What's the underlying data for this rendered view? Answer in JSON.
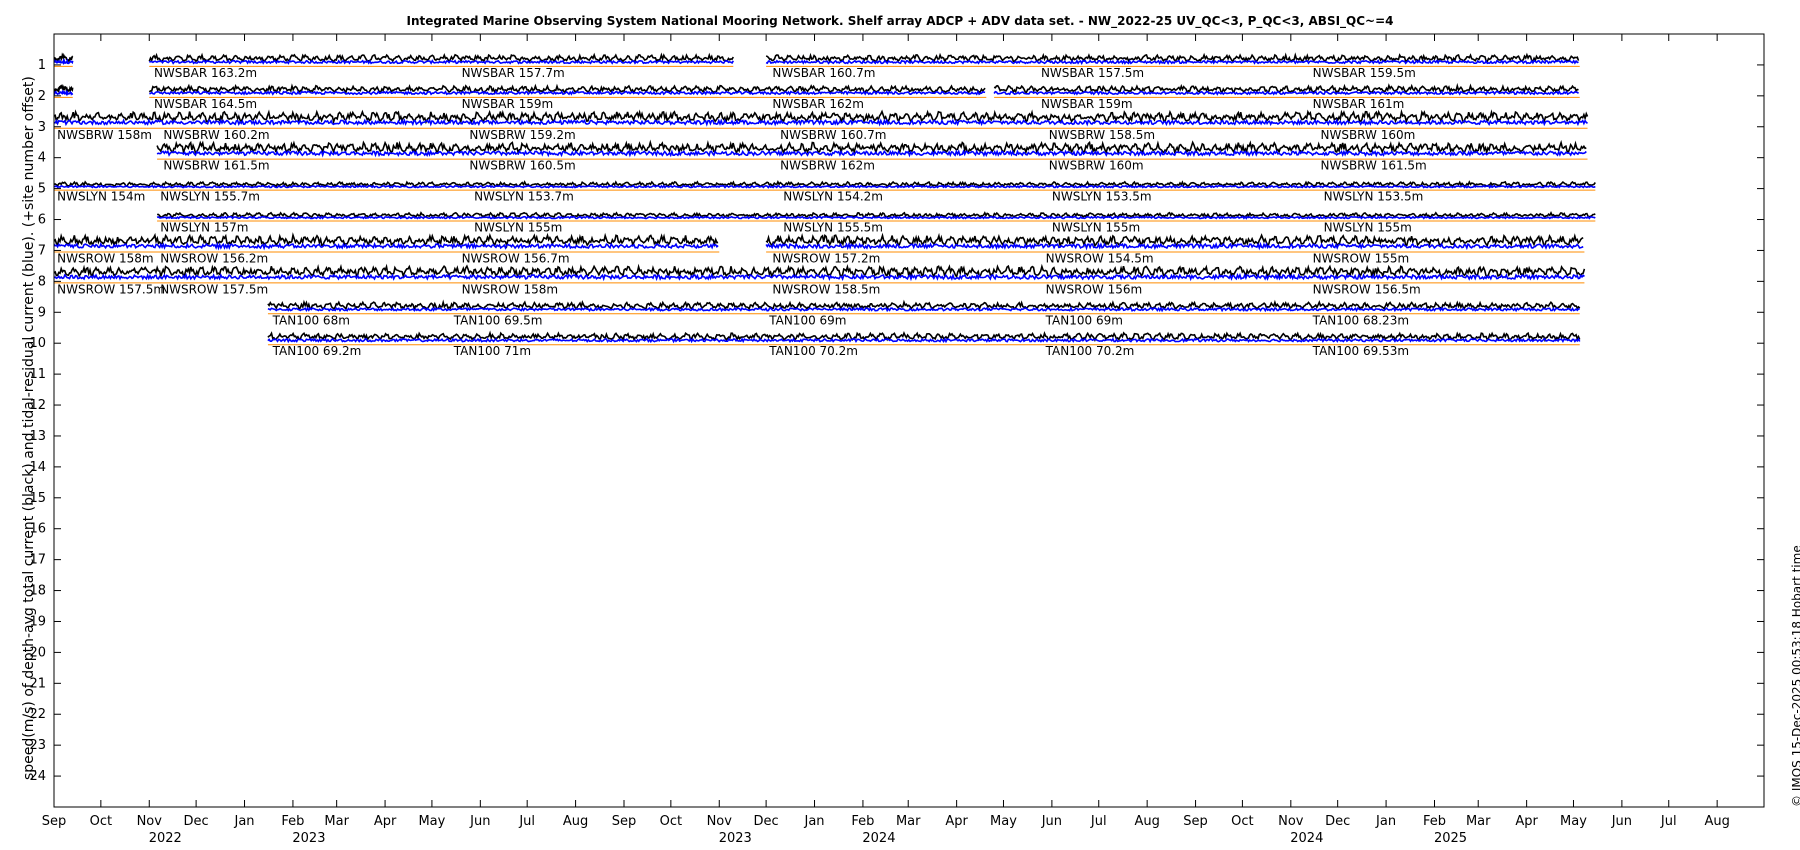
{
  "chart_data": {
    "type": "line",
    "title": "Integrated Marine Observing System National Mooring Network. Shelf array ADCP + ADV data set. - NW_2022-25 UV_QC<3, P_QC<3, ABSI_QC~=4",
    "ylabel": "speed(m/s) of depth-avg total current (black) and tidal-residual current (blue). (+site number offset)",
    "credit": "© IMOS 15-Dec-2025 00:53:18 Hobart time",
    "x_range": [
      "2022-09-01",
      "2025-08-31"
    ],
    "ylim": [
      0,
      25
    ],
    "y_reversed": true,
    "y_ticks": [
      1,
      2,
      3,
      4,
      5,
      6,
      7,
      8,
      9,
      10,
      11,
      12,
      13,
      14,
      15,
      16,
      17,
      18,
      19,
      20,
      21,
      22,
      23,
      24
    ],
    "x_ticks": [
      {
        "date": "2022-09-01",
        "label": "Sep"
      },
      {
        "date": "2022-10-01",
        "label": "Oct"
      },
      {
        "date": "2022-11-01",
        "label": "Nov",
        "year": "2022"
      },
      {
        "date": "2022-12-01",
        "label": "Dec"
      },
      {
        "date": "2023-01-01",
        "label": "Jan"
      },
      {
        "date": "2023-02-01",
        "label": "Feb",
        "year": "2023"
      },
      {
        "date": "2023-03-01",
        "label": "Mar"
      },
      {
        "date": "2023-04-01",
        "label": "Apr"
      },
      {
        "date": "2023-05-01",
        "label": "May"
      },
      {
        "date": "2023-06-01",
        "label": "Jun"
      },
      {
        "date": "2023-07-01",
        "label": "Jul"
      },
      {
        "date": "2023-08-01",
        "label": "Aug"
      },
      {
        "date": "2023-09-01",
        "label": "Sep"
      },
      {
        "date": "2023-10-01",
        "label": "Oct"
      },
      {
        "date": "2023-11-01",
        "label": "Nov",
        "year": "2023"
      },
      {
        "date": "2023-12-01",
        "label": "Dec"
      },
      {
        "date": "2024-01-01",
        "label": "Jan"
      },
      {
        "date": "2024-02-01",
        "label": "Feb",
        "year": "2024"
      },
      {
        "date": "2024-03-01",
        "label": "Mar"
      },
      {
        "date": "2024-04-01",
        "label": "Apr"
      },
      {
        "date": "2024-05-01",
        "label": "May"
      },
      {
        "date": "2024-06-01",
        "label": "Jun"
      },
      {
        "date": "2024-07-01",
        "label": "Jul"
      },
      {
        "date": "2024-08-01",
        "label": "Aug"
      },
      {
        "date": "2024-09-01",
        "label": "Sep"
      },
      {
        "date": "2024-10-01",
        "label": "Oct"
      },
      {
        "date": "2024-11-01",
        "label": "Nov",
        "year": "2024"
      },
      {
        "date": "2024-12-01",
        "label": "Dec"
      },
      {
        "date": "2025-01-01",
        "label": "Jan"
      },
      {
        "date": "2025-02-01",
        "label": "Feb",
        "year": "2025"
      },
      {
        "date": "2025-03-01",
        "label": "Mar"
      },
      {
        "date": "2025-04-01",
        "label": "Apr"
      },
      {
        "date": "2025-05-01",
        "label": "May"
      },
      {
        "date": "2025-06-01",
        "label": "Jun"
      },
      {
        "date": "2025-07-01",
        "label": "Jul"
      },
      {
        "date": "2025-08-01",
        "label": "Aug"
      }
    ],
    "colors": {
      "total": "#000000",
      "residual": "#0000ff",
      "zero_line_a": "#ff8c00",
      "zero_line_b": "#00cc66"
    },
    "rows": [
      {
        "site": 1,
        "amp": 0.3,
        "segments": [
          [
            "2022-09-01",
            "2022-09-13"
          ],
          [
            "2022-11-01",
            "2023-11-10"
          ],
          [
            "2023-12-01",
            "2025-05-05"
          ]
        ],
        "labels": [
          {
            "date": "2022-11-04",
            "text": "NWSBAR 163.2m"
          },
          {
            "date": "2023-05-20",
            "text": "NWSBAR 157.7m"
          },
          {
            "date": "2023-12-05",
            "text": "NWSBAR 160.7m"
          },
          {
            "date": "2024-05-25",
            "text": "NWSBAR 157.5m"
          },
          {
            "date": "2024-11-15",
            "text": "NWSBAR 159.5m"
          }
        ]
      },
      {
        "site": 2,
        "amp": 0.3,
        "segments": [
          [
            "2022-09-01",
            "2022-09-13"
          ],
          [
            "2022-11-01",
            "2024-04-20"
          ],
          [
            "2024-04-25",
            "2025-05-05"
          ]
        ],
        "labels": [
          {
            "date": "2022-11-04",
            "text": "NWSBAR 164.5m"
          },
          {
            "date": "2023-05-20",
            "text": "NWSBAR 159m"
          },
          {
            "date": "2023-12-05",
            "text": "NWSBAR 162m"
          },
          {
            "date": "2024-05-25",
            "text": "NWSBAR 159m"
          },
          {
            "date": "2024-11-15",
            "text": "NWSBAR 161m"
          }
        ]
      },
      {
        "site": 3,
        "amp": 0.45,
        "segments": [
          [
            "2022-09-01",
            "2025-05-10"
          ]
        ],
        "labels": [
          {
            "date": "2022-09-03",
            "text": "NWSBRW 158m"
          },
          {
            "date": "2022-11-10",
            "text": "NWSBRW 160.2m"
          },
          {
            "date": "2023-05-25",
            "text": "NWSBRW 159.2m"
          },
          {
            "date": "2023-12-10",
            "text": "NWSBRW 160.7m"
          },
          {
            "date": "2024-05-30",
            "text": "NWSBRW 158.5m"
          },
          {
            "date": "2024-11-20",
            "text": "NWSBRW 160m"
          }
        ]
      },
      {
        "site": 4,
        "amp": 0.45,
        "segments": [
          [
            "2022-11-06",
            "2025-05-10"
          ]
        ],
        "labels": [
          {
            "date": "2022-11-10",
            "text": "NWSBRW 161.5m"
          },
          {
            "date": "2023-05-25",
            "text": "NWSBRW 160.5m"
          },
          {
            "date": "2023-12-10",
            "text": "NWSBRW 162m"
          },
          {
            "date": "2024-05-30",
            "text": "NWSBRW 160m"
          },
          {
            "date": "2024-11-20",
            "text": "NWSBRW 161.5m"
          }
        ]
      },
      {
        "site": 5,
        "amp": 0.2,
        "segments": [
          [
            "2022-09-01",
            "2025-05-15"
          ]
        ],
        "labels": [
          {
            "date": "2022-09-03",
            "text": "NWSLYN 154m"
          },
          {
            "date": "2022-11-08",
            "text": "NWSLYN 155.7m"
          },
          {
            "date": "2023-05-28",
            "text": "NWSLYN 153.7m"
          },
          {
            "date": "2023-12-12",
            "text": "NWSLYN 154.2m"
          },
          {
            "date": "2024-06-01",
            "text": "NWSLYN 153.5m"
          },
          {
            "date": "2024-11-22",
            "text": "NWSLYN 153.5m"
          }
        ]
      },
      {
        "site": 6,
        "amp": 0.2,
        "segments": [
          [
            "2022-11-06",
            "2025-05-15"
          ]
        ],
        "labels": [
          {
            "date": "2022-11-08",
            "text": "NWSLYN 157m"
          },
          {
            "date": "2023-05-28",
            "text": "NWSLYN 155m"
          },
          {
            "date": "2023-12-12",
            "text": "NWSLYN 155.5m"
          },
          {
            "date": "2024-06-01",
            "text": "NWSLYN 155m"
          },
          {
            "date": "2024-11-22",
            "text": "NWSLYN 155m"
          }
        ]
      },
      {
        "site": 7,
        "amp": 0.45,
        "segments": [
          [
            "2022-09-01",
            "2023-11-01"
          ],
          [
            "2023-12-01",
            "2025-05-08"
          ]
        ],
        "labels": [
          {
            "date": "2022-09-03",
            "text": "NWSROW 158m"
          },
          {
            "date": "2022-11-08",
            "text": "NWSROW 156.2m"
          },
          {
            "date": "2023-05-20",
            "text": "NWSROW 156.7m"
          },
          {
            "date": "2023-12-05",
            "text": "NWSROW 157.2m"
          },
          {
            "date": "2024-05-28",
            "text": "NWSROW 154.5m"
          },
          {
            "date": "2024-11-15",
            "text": "NWSROW 155m"
          }
        ]
      },
      {
        "site": 8,
        "amp": 0.45,
        "segments": [
          [
            "2022-09-01",
            "2025-05-08"
          ]
        ],
        "labels": [
          {
            "date": "2022-09-03",
            "text": "NWSROW 157.5m"
          },
          {
            "date": "2022-11-08",
            "text": "NWSROW 157.5m"
          },
          {
            "date": "2023-05-20",
            "text": "NWSROW 158m"
          },
          {
            "date": "2023-12-05",
            "text": "NWSROW 158.5m"
          },
          {
            "date": "2024-05-28",
            "text": "NWSROW 156m"
          },
          {
            "date": "2024-11-15",
            "text": "NWSROW 156.5m"
          }
        ]
      },
      {
        "site": 9,
        "amp": 0.3,
        "segments": [
          [
            "2023-01-16",
            "2025-05-05"
          ]
        ],
        "labels": [
          {
            "date": "2023-01-19",
            "text": "TAN100 68m"
          },
          {
            "date": "2023-05-15",
            "text": "TAN100 69.5m"
          },
          {
            "date": "2023-12-03",
            "text": "TAN100 69m"
          },
          {
            "date": "2024-05-28",
            "text": "TAN100 69m"
          },
          {
            "date": "2024-11-15",
            "text": "TAN100 68.23m"
          }
        ]
      },
      {
        "site": 10,
        "amp": 0.3,
        "segments": [
          [
            "2023-01-16",
            "2025-05-05"
          ]
        ],
        "labels": [
          {
            "date": "2023-01-19",
            "text": "TAN100 69.2m"
          },
          {
            "date": "2023-05-15",
            "text": "TAN100 71m"
          },
          {
            "date": "2023-12-03",
            "text": "TAN100 70.2m"
          },
          {
            "date": "2024-05-28",
            "text": "TAN100 70.2m"
          },
          {
            "date": "2024-11-15",
            "text": "TAN100 69.53m"
          }
        ]
      }
    ]
  }
}
